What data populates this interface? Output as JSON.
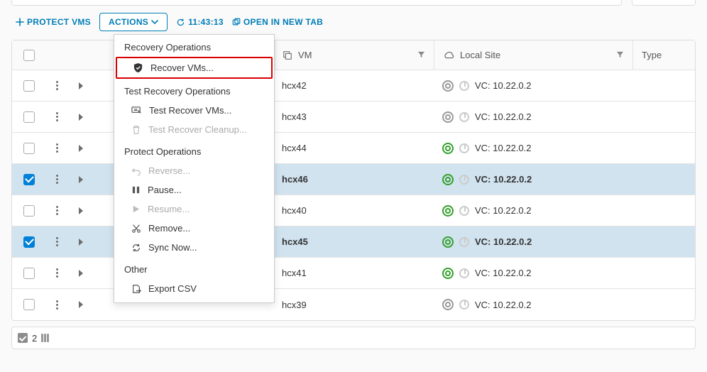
{
  "toolbar": {
    "protect_label": "PROTECT VMS",
    "actions_label": "ACTIONS",
    "timestamp": "11:43:13",
    "open_tab_label": "OPEN IN NEW TAB"
  },
  "columns": {
    "vm": "VM",
    "local_site": "Local Site",
    "type": "Type"
  },
  "dropdown": {
    "recovery_title": "Recovery Operations",
    "recover_vms": "Recover VMs...",
    "test_recovery_title": "Test Recovery Operations",
    "test_recover_vms": "Test Recover VMs...",
    "test_recover_cleanup": "Test Recover Cleanup...",
    "protect_title": "Protect Operations",
    "reverse": "Reverse...",
    "pause": "Pause...",
    "resume": "Resume...",
    "remove": "Remove...",
    "sync_now": "Sync Now...",
    "other_title": "Other",
    "export_csv": "Export CSV"
  },
  "rows": [
    {
      "vm": "hcx42",
      "site": "VC: 10.22.0.2",
      "status": "grey",
      "checked": false
    },
    {
      "vm": "hcx43",
      "site": "VC: 10.22.0.2",
      "status": "grey",
      "checked": false
    },
    {
      "vm": "hcx44",
      "site": "VC: 10.22.0.2",
      "status": "green",
      "checked": false
    },
    {
      "vm": "hcx46",
      "site": "VC: 10.22.0.2",
      "status": "green",
      "checked": true
    },
    {
      "vm": "hcx40",
      "site": "VC: 10.22.0.2",
      "status": "green",
      "checked": false
    },
    {
      "vm": "hcx45",
      "site": "VC: 10.22.0.2",
      "status": "green",
      "checked": true
    },
    {
      "vm": "hcx41",
      "site": "VC: 10.22.0.2",
      "status": "green",
      "checked": false
    },
    {
      "vm": "hcx39",
      "site": "VC: 10.22.0.2",
      "status": "grey",
      "checked": false
    }
  ],
  "footer": {
    "selection_count": "2"
  }
}
